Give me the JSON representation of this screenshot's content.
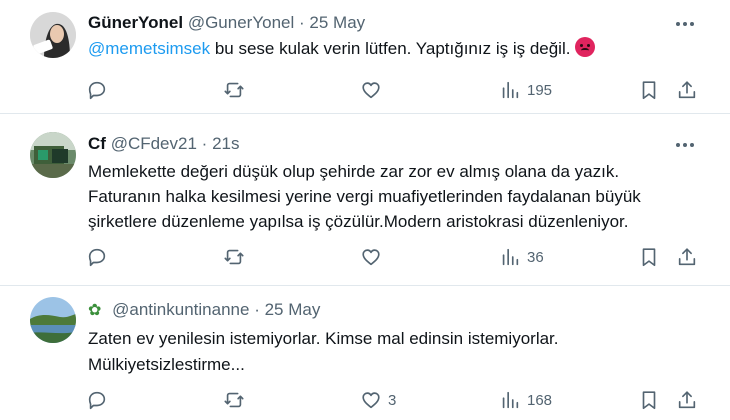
{
  "colors": {
    "accent": "#1d9bf0",
    "muted": "#536471",
    "text": "#0f1419",
    "divider": "#e1e8ed"
  },
  "tweets": [
    {
      "display_name": "GünerYonel",
      "handle": "@GunerYonel",
      "separator": "·",
      "time": "25 May",
      "mention": "@memetsimsek",
      "text": " bu sese kulak verin lütfen. Yaptığınız iş iş değil.",
      "emoji": "angry-face-icon",
      "views": "195",
      "replies": "",
      "likes": ""
    },
    {
      "display_name": "Cf",
      "handle": "@CFdev21",
      "separator": "·",
      "time": "21s",
      "lines": [
        "Memlekette değeri düşük olup şehirde zar zor ev almış olana da yazık.",
        "Faturanın halka kesilmesi yerine vergi muafiyetlerinden faydalanan büyük",
        "şirketlere düzenleme yapılsa iş çözülür.Modern aristokrasi düzenleniyor."
      ],
      "views": "36"
    },
    {
      "display_name_icon": "leaf-icon",
      "handle": "@antinkuntinanne",
      "separator": "·",
      "time": "25 May",
      "lines": [
        "Zaten ev yenilesin istemiyorlar. Kimse mal edinsin istemiyorlar.",
        "Mülkiyetsizlestirme..."
      ],
      "likes": "3",
      "views": "168"
    }
  ]
}
